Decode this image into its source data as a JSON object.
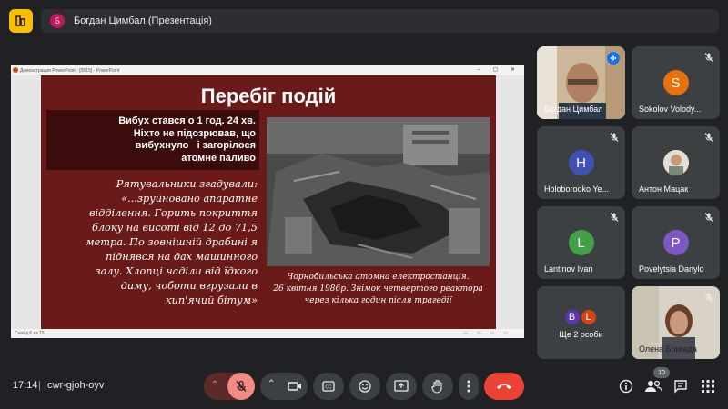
{
  "header": {
    "avatar_letter": "Б",
    "title": "Богдан Цимбал (Презентація)"
  },
  "powerpoint": {
    "window_title": "Демонстрация PowerPoint - [0515] - PowerPoint",
    "status": "Слайд 6 из 15"
  },
  "slide": {
    "title": "Перебіг подій",
    "box_lines": [
      "Вибух стався о 1 год. 24 хв.",
      "Ніхто не підозрював, що",
      "вибухнуло   і загорілося",
      "атомне паливо"
    ],
    "quote_lines": [
      "Рятувальники згадували:",
      "«...зруйновано апаратне",
      "відділення. Горить покриття",
      "блоку на висоті від 12 до 71,5",
      "метра. По зовнішній драбині я",
      "піднявся на дах машинного",
      "залу. Хлопці чаділи від їдкого",
      "диму, чоботи вгрузали в",
      "кип'ячий бітум»"
    ],
    "caption_lines": [
      "Чорнобильська атомна електростанція.",
      "26 квітня 1986р. Знімок четвертого реактора",
      "через кілька годин після трагедії"
    ]
  },
  "participants": [
    {
      "name": "Богдан Цимбал",
      "type": "video",
      "speaking": true
    },
    {
      "name": "Sokolov Volody...",
      "initial": "S",
      "color": "#e8710a",
      "muted": true
    },
    {
      "name": "Holoborodko Ye...",
      "initial": "H",
      "color": "#3f51b5",
      "muted": true
    },
    {
      "name": "Антон Мацак",
      "type": "photo",
      "muted": true
    },
    {
      "name": "Lantinov Ivan",
      "initial": "L",
      "color": "#43a047",
      "muted": true
    },
    {
      "name": "Povelytsia Danylo",
      "initial": "P",
      "color": "#7e57c2",
      "muted": true
    },
    {
      "name": "Ще 2 особи",
      "type": "more",
      "avatars": [
        {
          "initial": "B",
          "color": "#5e35b1"
        },
        {
          "initial": "L",
          "color": "#d84315"
        }
      ]
    },
    {
      "name": "Олена Бригада",
      "type": "video",
      "muted": true
    }
  ],
  "bottom": {
    "time": "17:14",
    "separator": "|",
    "meeting_code": "cwr-gjoh-oyv",
    "people_count": "10"
  },
  "colors": {
    "end_call": "#ea4335",
    "mic_off": "#f28b82",
    "slide_bg": "#6b1a1a"
  }
}
